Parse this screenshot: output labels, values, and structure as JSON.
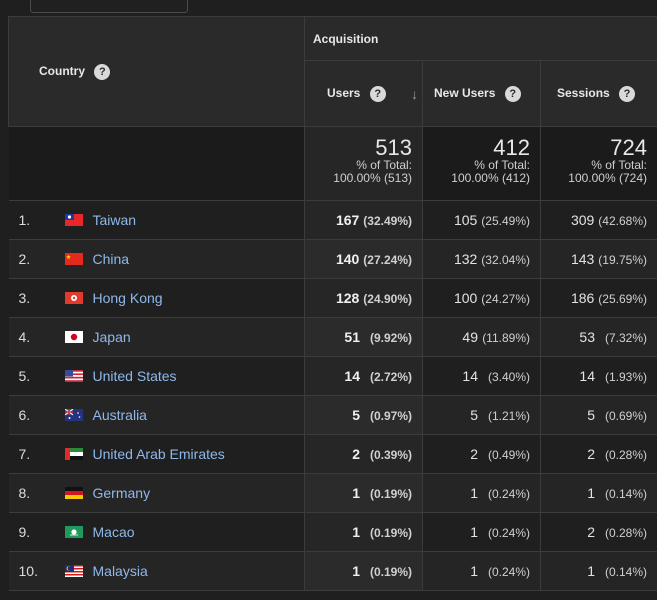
{
  "header": {
    "country_label": "Country",
    "acquisition_label": "Acquisition",
    "users_label": "Users",
    "new_users_label": "New Users",
    "sessions_label": "Sessions",
    "help_glyph": "?",
    "sort_glyph": "↓"
  },
  "totals": {
    "users": {
      "value": "513",
      "line1": "% of Total:",
      "line2": "100.00% (513)"
    },
    "new_users": {
      "value": "412",
      "line1": "% of Total:",
      "line2": "100.00% (412)"
    },
    "sessions": {
      "value": "724",
      "line1": "% of Total:",
      "line2": "100.00% (724)"
    }
  },
  "rows": [
    {
      "index": "1.",
      "country": "Taiwan",
      "flag": "taiwan-flag-icon",
      "users": "167",
      "users_pct": "(32.49%)",
      "new_users": "105",
      "new_users_pct": "(25.49%)",
      "sessions": "309",
      "sessions_pct": "(42.68%)"
    },
    {
      "index": "2.",
      "country": "China",
      "flag": "china-flag-icon",
      "users": "140",
      "users_pct": "(27.24%)",
      "new_users": "132",
      "new_users_pct": "(32.04%)",
      "sessions": "143",
      "sessions_pct": "(19.75%)"
    },
    {
      "index": "3.",
      "country": "Hong Kong",
      "flag": "hong-kong-flag-icon",
      "users": "128",
      "users_pct": "(24.90%)",
      "new_users": "100",
      "new_users_pct": "(24.27%)",
      "sessions": "186",
      "sessions_pct": "(25.69%)"
    },
    {
      "index": "4.",
      "country": "Japan",
      "flag": "japan-flag-icon",
      "users": "51",
      "users_pct": "(9.92%)",
      "new_users": "49",
      "new_users_pct": "(11.89%)",
      "sessions": "53",
      "sessions_pct": "(7.32%)"
    },
    {
      "index": "5.",
      "country": "United States",
      "flag": "united-states-flag-icon",
      "users": "14",
      "users_pct": "(2.72%)",
      "new_users": "14",
      "new_users_pct": "(3.40%)",
      "sessions": "14",
      "sessions_pct": "(1.93%)"
    },
    {
      "index": "6.",
      "country": "Australia",
      "flag": "australia-flag-icon",
      "users": "5",
      "users_pct": "(0.97%)",
      "new_users": "5",
      "new_users_pct": "(1.21%)",
      "sessions": "5",
      "sessions_pct": "(0.69%)"
    },
    {
      "index": "7.",
      "country": "United Arab Emirates",
      "flag": "uae-flag-icon",
      "users": "2",
      "users_pct": "(0.39%)",
      "new_users": "2",
      "new_users_pct": "(0.49%)",
      "sessions": "2",
      "sessions_pct": "(0.28%)"
    },
    {
      "index": "8.",
      "country": "Germany",
      "flag": "germany-flag-icon",
      "users": "1",
      "users_pct": "(0.19%)",
      "new_users": "1",
      "new_users_pct": "(0.24%)",
      "sessions": "1",
      "sessions_pct": "(0.14%)"
    },
    {
      "index": "9.",
      "country": "Macao",
      "flag": "macao-flag-icon",
      "users": "1",
      "users_pct": "(0.19%)",
      "new_users": "1",
      "new_users_pct": "(0.24%)",
      "sessions": "2",
      "sessions_pct": "(0.28%)"
    },
    {
      "index": "10.",
      "country": "Malaysia",
      "flag": "malaysia-flag-icon",
      "users": "1",
      "users_pct": "(0.19%)",
      "new_users": "1",
      "new_users_pct": "(0.24%)",
      "sessions": "1",
      "sessions_pct": "(0.14%)"
    }
  ]
}
